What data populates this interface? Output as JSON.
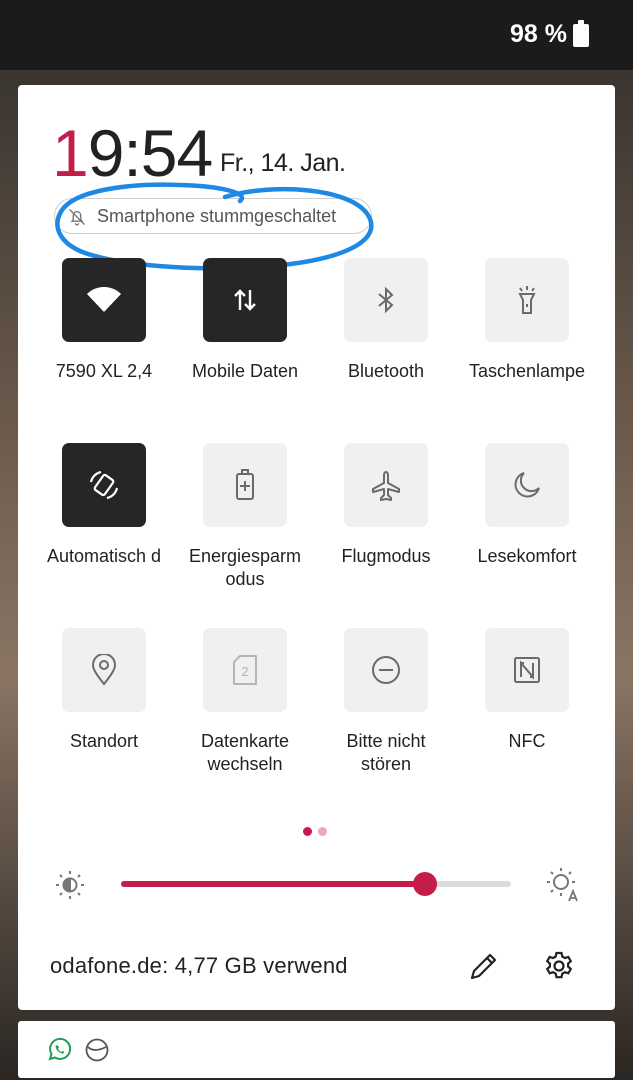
{
  "status_bar": {
    "battery": "98 %"
  },
  "header": {
    "clock_first": "1",
    "clock_rest": "9:54",
    "date": "Fr., 14. Jan.",
    "silent_label": "Smartphone stummgeschaltet"
  },
  "tiles": [
    {
      "label": "7590 XL 2,4",
      "icon": "wifi-icon",
      "active": true
    },
    {
      "label": "Mobile Daten",
      "icon": "mobile-data-icon",
      "active": true
    },
    {
      "label": "Bluetooth",
      "icon": "bluetooth-icon",
      "active": false
    },
    {
      "label": "Taschenlampe",
      "icon": "flashlight-icon",
      "active": false
    },
    {
      "label": "Automatisch d",
      "icon": "auto-rotate-icon",
      "active": true
    },
    {
      "label": "Energiesparm odus",
      "icon": "battery-saver-icon",
      "active": false
    },
    {
      "label": "Flugmodus",
      "icon": "airplane-icon",
      "active": false
    },
    {
      "label": "Lesekomfort",
      "icon": "moon-icon",
      "active": false
    },
    {
      "label": "Standort",
      "icon": "location-icon",
      "active": false
    },
    {
      "label": "Datenkarte wechseln",
      "icon": "sim-card-icon",
      "active": false
    },
    {
      "label": "Bitte nicht stören",
      "icon": "do-not-disturb-icon",
      "active": false
    },
    {
      "label": "NFC",
      "icon": "nfc-icon",
      "active": false
    }
  ],
  "tile_labels": {
    "t0": "7590 XL 2,4",
    "t1": "Mobile Daten",
    "t2": "Bluetooth",
    "t3": "Taschenlampe",
    "t4": "Automatisch d",
    "t5a": "Energiesparm",
    "t5b": "odus",
    "t6": "Flugmodus",
    "t7": "Lesekomfort",
    "t8": "Standort",
    "t9a": "Datenkarte",
    "t9b": "wechseln",
    "t10a": "Bitte nicht",
    "t10b": "stören",
    "t11": "NFC"
  },
  "sim_number": "2",
  "pager": {
    "pages": 2,
    "current": 1
  },
  "brightness": {
    "level": 0.78
  },
  "footer": {
    "carrier_usage": "odafone.de: 4,77 GB verwend"
  },
  "colors": {
    "accent": "#c41e48",
    "tile_active": "#262626",
    "tile_inactive": "#f0f0f0",
    "annotation": "#1e88e5"
  },
  "notifications": {
    "icons": [
      "whatsapp-icon",
      "moon-icon"
    ]
  }
}
